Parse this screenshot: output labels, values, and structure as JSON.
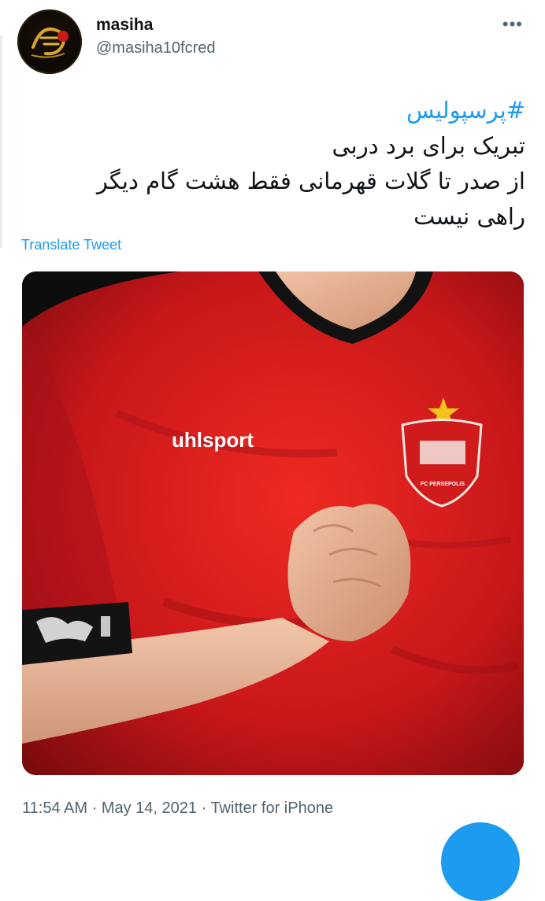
{
  "user": {
    "display_name": "masiha",
    "handle": "@masiha10fcred"
  },
  "menu_glyph": "•••",
  "tweet": {
    "hashtag": "#پرسپولیس",
    "lines": [
      "تبریک برای برد دربی",
      "از صدر تا گلات قهرمانی فقط هشت گام دیگر",
      "راهی نیست"
    ],
    "translate_label": "Translate Tweet"
  },
  "media": {
    "brand_text": "uhlsport",
    "crest_text": "FC PERSEPOLIS",
    "colors": {
      "shirt": "#d81e1a",
      "collar": "#121212",
      "star": "#f3c21b"
    }
  },
  "meta": {
    "time": "11:54 AM",
    "separator": " · ",
    "date": "May 14, 2021",
    "source": "Twitter for iPhone"
  },
  "icons": [
    "avatar",
    "more-icon",
    "compose-fab"
  ]
}
